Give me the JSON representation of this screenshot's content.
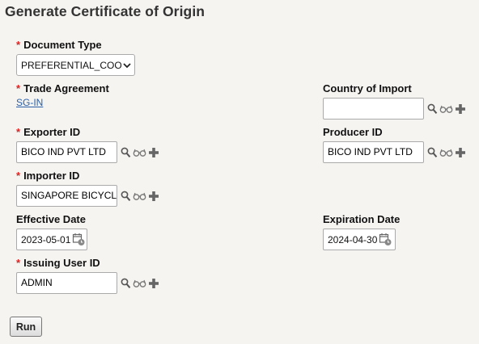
{
  "page": {
    "title": "Generate Certificate of Origin"
  },
  "fields": {
    "document_type": {
      "label": "Document Type",
      "required_mark": "*",
      "value": "PREFERENTIAL_COO"
    },
    "trade_agreement": {
      "label": "Trade Agreement",
      "required_mark": "*",
      "value": "SG-IN"
    },
    "country_of_import": {
      "label": "Country of Import",
      "value": ""
    },
    "exporter_id": {
      "label": "Exporter ID",
      "required_mark": "*",
      "value": "BICO IND PVT LTD"
    },
    "producer_id": {
      "label": "Producer ID",
      "value": "BICO IND PVT LTD"
    },
    "importer_id": {
      "label": "Importer ID",
      "required_mark": "*",
      "value": "SINGAPORE BICYCLE"
    },
    "effective_date": {
      "label": "Effective Date",
      "value": "2023-05-01"
    },
    "expiration_date": {
      "label": "Expiration Date",
      "value": "2024-04-30"
    },
    "issuing_user_id": {
      "label": "Issuing User ID",
      "required_mark": "*",
      "value": "ADMIN"
    }
  },
  "buttons": {
    "run_label": "Run"
  },
  "icons": {
    "lookup": "search-icon",
    "view": "glasses-icon",
    "add": "plus-icon",
    "calendar": "calendar-icon"
  },
  "colors": {
    "background": "#f6f4f1",
    "required": "#dd2222",
    "link": "#2a5fa7",
    "icon": "#555555"
  }
}
